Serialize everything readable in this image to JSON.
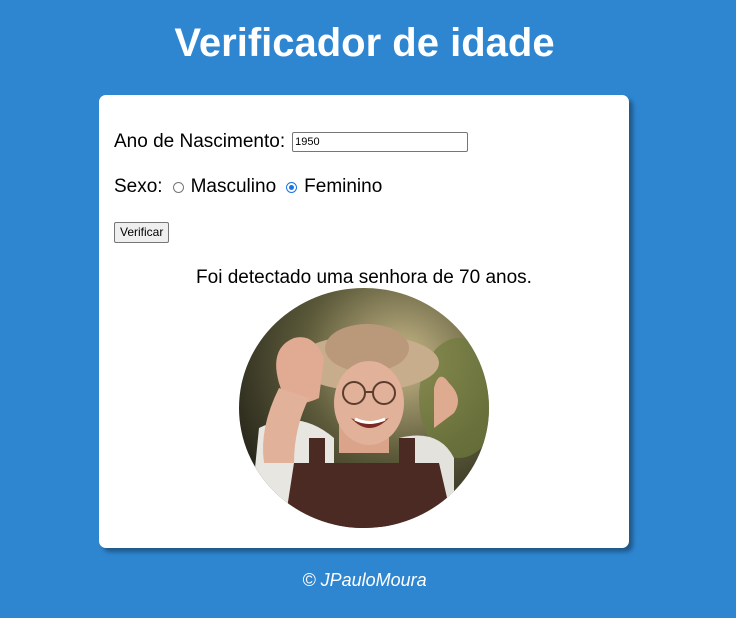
{
  "header": {
    "title": "Verificador de idade"
  },
  "form": {
    "ano_label": "Ano de Nascimento:",
    "ano_value": "1950",
    "sexo_label": "Sexo:",
    "options": [
      {
        "label": "Masculino",
        "checked": false
      },
      {
        "label": "Feminino",
        "checked": true
      }
    ],
    "button_label": "Verificar"
  },
  "result": {
    "text": "Foi detectado uma senhora de 70 anos.",
    "image": "elderly-woman-photo"
  },
  "footer": {
    "text": "© JPauloMoura"
  },
  "colors": {
    "background": "#2e86d1",
    "card": "#ffffff",
    "radio_accent": "#1a73e8"
  }
}
